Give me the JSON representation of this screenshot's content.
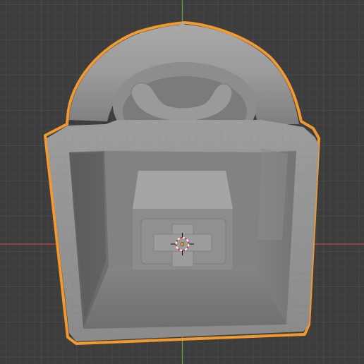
{
  "viewport": {
    "grid": true,
    "axis_colors": {
      "x": "#c9424a",
      "y": "#6fa33a"
    },
    "selection_outline_color": "#f29a2e",
    "background_color": "#3d3d3d"
  },
  "object": {
    "kind": "padlock-shaped mesh",
    "state": "selected"
  },
  "icons": {
    "cursor": "3d-cursor-icon",
    "origin": "object-origin-icon"
  }
}
